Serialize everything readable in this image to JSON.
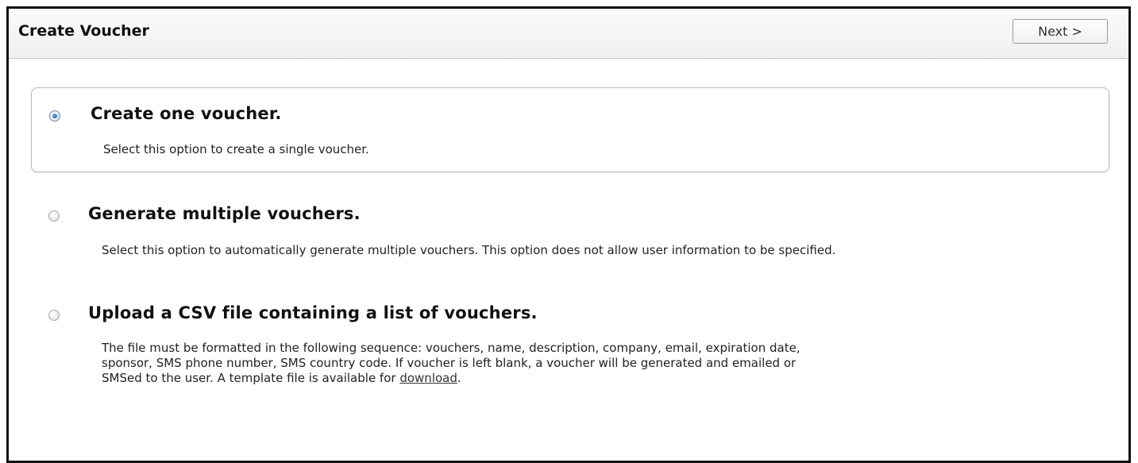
{
  "header": {
    "title": "Create Voucher",
    "next_label": "Next >"
  },
  "options": [
    {
      "title": "Create one voucher.",
      "description": "Select this option to create a single voucher.",
      "selected": true
    },
    {
      "title": "Generate multiple vouchers.",
      "description": "Select this option to automatically generate multiple vouchers. This option does not allow user information to be specified.",
      "selected": false
    },
    {
      "title": "Upload a CSV file containing a list of vouchers.",
      "description_line1": "The file must be formatted in the following sequence: vouchers, name, description, company, email, expiration date,",
      "description_line2": "sponsor, SMS phone number, SMS country code. If voucher is left blank, a voucher will be generated and emailed or",
      "description_line3_prefix": "SMSed to the user. A template file is available for ",
      "download_link": "download",
      "description_line3_suffix": ".",
      "selected": false
    }
  ]
}
